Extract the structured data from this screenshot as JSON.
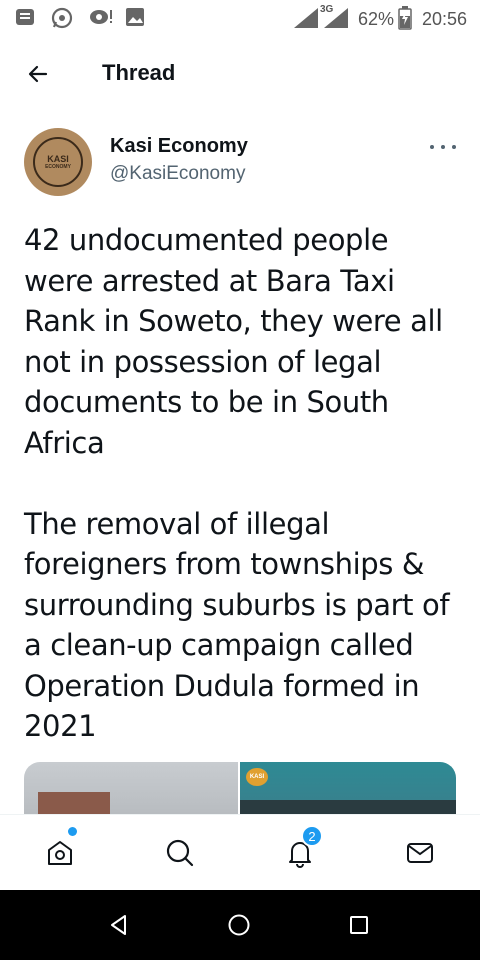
{
  "status_bar": {
    "network": "3G",
    "battery": "62%",
    "time": "20:56"
  },
  "header": {
    "title": "Thread"
  },
  "tweet": {
    "author_name": "Kasi Economy",
    "author_handle": "@KasiEconomy",
    "avatar_text_top": "KASI",
    "avatar_text_bottom": "ECONOMY",
    "text": "42 undocumented people were arrested at Bara Taxi Rank in Soweto, they were all not in possession of legal documents to be in South Africa\n\nThe removal of illegal foreigners from townships & surrounding suburbs is part of a clean-up campaign called Operation Dudula formed in 2021",
    "media_sticker": "KASI"
  },
  "bottom_nav": {
    "notifications_count": "2"
  },
  "colors": {
    "accent": "#1d9bf0",
    "text_primary": "#0f1419",
    "text_secondary": "#536471"
  }
}
